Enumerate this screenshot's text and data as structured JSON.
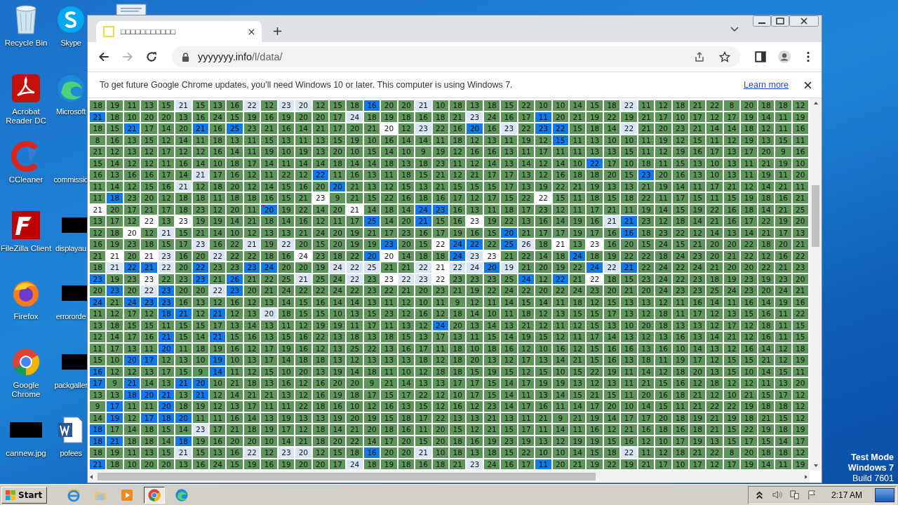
{
  "desktop": {
    "icons": [
      {
        "label": "Recycle Bin",
        "kind": "recycle"
      },
      {
        "label": "Acrobat Reader DC",
        "kind": "acrobat"
      },
      {
        "label": "CCleaner",
        "kind": "ccleaner"
      },
      {
        "label": "FileZilla Client",
        "kind": "filezilla"
      },
      {
        "label": "Firefox",
        "kind": "firefox"
      },
      {
        "label": "Google Chrome",
        "kind": "chrome"
      },
      {
        "label": "cannew.jpg",
        "kind": "redacted"
      }
    ],
    "icons_second_column": [
      {
        "label": "Skype",
        "kind": "skype"
      },
      {
        "label": "Microsoft",
        "kind": "edge"
      },
      {
        "label": "commissio",
        "kind": "blank"
      },
      {
        "label": "displayau",
        "kind": "redacted"
      },
      {
        "label": "errororde",
        "kind": "redacted"
      },
      {
        "label": "packgaller",
        "kind": "redacted"
      },
      {
        "label": "pofees",
        "kind": "word"
      }
    ],
    "watermark": [
      "Test Mode",
      "Windows 7",
      "Build 7601"
    ]
  },
  "browser": {
    "tab": {
      "title": "□□□□□□□□□□□"
    },
    "address": {
      "host": "yyyyyyy.info",
      "path": "/l/data/"
    },
    "infobar": {
      "message": "To get future Google Chrome updates, you'll need Windows 10 or later. This computer is using Windows 7.",
      "link": "Learn more"
    },
    "grid": {
      "rows": [
        {
          "cells": [
            "18",
            "19",
            "11",
            "13",
            "15",
            {
              "text": "21",
              "kind": "light"
            },
            "15",
            "13",
            "16",
            {
              "text": "22",
              "kind": "light"
            },
            "12",
            {
              "text": "23",
              "kind": "light"
            },
            {
              "text": "20",
              "kind": "light"
            },
            "12",
            "15",
            "18",
            {
              "text": "16",
              "kind": "blue"
            },
            "20",
            "20",
            {
              "text": "21",
              "kind": "light"
            },
            "10",
            "18",
            "13",
            "18",
            "15",
            "22",
            "10",
            "10",
            "14",
            "15",
            "18",
            {
              "text": "22",
              "kind": "light"
            },
            "11",
            "12",
            "18",
            "21",
            "22",
            "8",
            "20",
            "18",
            "18",
            "12"
          ]
        },
        {
          "cells": [
            {
              "text": "21",
              "kind": "blue"
            },
            "18",
            "10",
            "20",
            "20",
            "13",
            "16",
            "24",
            "15",
            "19",
            "16",
            "19",
            "20",
            "20",
            "17",
            {
              "text": "24",
              "kind": "light"
            },
            "18",
            "19",
            "18",
            "16",
            "18",
            "21",
            {
              "text": "23",
              "kind": "light"
            },
            "24",
            "16",
            "17",
            {
              "text": "11",
              "kind": "blue"
            },
            "20",
            "21",
            "19",
            "22",
            "19",
            "21",
            "17",
            "10",
            "17",
            "12",
            "17",
            "19",
            "14",
            "11",
            "19"
          ]
        },
        {
          "cells": [
            "18",
            "15",
            {
              "text": "21",
              "kind": "blue"
            },
            "17",
            "14",
            "20",
            {
              "text": "21",
              "kind": "blue"
            },
            "16",
            {
              "text": "25",
              "kind": "blue"
            },
            "23",
            "21",
            "16",
            "14",
            "21",
            "17",
            "20",
            "21",
            {
              "text": "20",
              "kind": "white"
            },
            "12",
            {
              "text": "23",
              "kind": "light"
            },
            "22",
            "16",
            {
              "text": "20",
              "kind": "blue"
            },
            "16",
            {
              "text": "23",
              "kind": "light"
            },
            "22",
            {
              "text": "23",
              "kind": "blue"
            },
            {
              "text": "22",
              "kind": "blue"
            },
            "15",
            "18",
            "14",
            {
              "text": "22",
              "kind": "light"
            },
            "21",
            "20",
            "23",
            "21",
            "14",
            "14",
            "18",
            "12",
            "11",
            "16"
          ]
        },
        {
          "cells": [
            "8",
            "16",
            "13",
            "15",
            "12",
            "14",
            "11",
            "18",
            "13",
            "11",
            "15",
            "13",
            "11",
            "13",
            "15",
            "19",
            "10",
            "16",
            "14",
            "14",
            "11",
            "18",
            "12",
            "13",
            "11",
            "19",
            "12",
            {
              "text": "15",
              "kind": "blue"
            },
            "11",
            "13",
            "10",
            "10",
            "11",
            "19",
            "12",
            "15",
            "11",
            "12",
            "19",
            "13",
            "15",
            "11"
          ]
        },
        {
          "cells": [
            "21",
            "12",
            "13",
            "12",
            "17",
            "12",
            "12",
            "16",
            "14",
            "11",
            "19",
            "10",
            "19",
            "13",
            "20",
            "10",
            "15",
            "14",
            "10",
            "9",
            "19",
            "12",
            "16",
            "16",
            "13",
            "11",
            "17",
            "11",
            "11",
            "13",
            "13",
            "15",
            "11",
            "12",
            "19",
            "16",
            "17",
            "13",
            "17",
            "20",
            "9",
            "16"
          ]
        },
        {
          "cells": [
            "15",
            "14",
            "12",
            "12",
            "11",
            "16",
            "14",
            "10",
            "18",
            "17",
            "14",
            "11",
            "14",
            "14",
            "18",
            "14",
            "14",
            "18",
            "13",
            "18",
            "23",
            "11",
            "12",
            "14",
            "13",
            "14",
            "12",
            "14",
            "10",
            {
              "text": "22",
              "kind": "blue"
            },
            "17",
            "10",
            "18",
            "11",
            "15",
            "13",
            "10",
            "13",
            "11",
            "21",
            "19",
            "10"
          ]
        },
        {
          "cells": [
            "16",
            "13",
            "16",
            "16",
            "17",
            "14",
            {
              "text": "21",
              "kind": "light"
            },
            "17",
            "16",
            "12",
            "11",
            "22",
            "12",
            {
              "text": "22",
              "kind": "blue"
            },
            "11",
            "16",
            "13",
            "11",
            "18",
            "15",
            "21",
            "12",
            "21",
            "17",
            "17",
            "13",
            "12",
            "16",
            "18",
            "18",
            "20",
            "15",
            {
              "text": "23",
              "kind": "blue"
            },
            "20",
            "16",
            "13",
            "10",
            "13",
            "11",
            "19",
            "11",
            "20"
          ]
        },
        {
          "cells": [
            "11",
            "14",
            "12",
            "15",
            "16",
            {
              "text": "21",
              "kind": "light"
            },
            "12",
            "18",
            "20",
            "12",
            "14",
            "15",
            "16",
            "20",
            {
              "text": "20",
              "kind": "blue"
            },
            "21",
            "13",
            "12",
            "15",
            "13",
            "21",
            "15",
            "15",
            "15",
            "17",
            "13",
            "19",
            "22",
            "21",
            "19",
            "13",
            "13",
            "21",
            "19",
            "14",
            "11",
            "17",
            "21",
            "12",
            "14",
            "21",
            "11"
          ]
        },
        {
          "cells": [
            "11",
            {
              "text": "18",
              "kind": "blue"
            },
            "23",
            "20",
            "12",
            "18",
            "18",
            "11",
            "18",
            "18",
            "16",
            "15",
            "21",
            {
              "text": "23",
              "kind": "white"
            },
            "9",
            "21",
            "15",
            "22",
            "16",
            "18",
            "16",
            "17",
            "12",
            "17",
            "15",
            "22",
            {
              "text": "22",
              "kind": "white"
            },
            "15",
            "11",
            "18",
            "15",
            "18",
            "22",
            "11",
            "17",
            "15",
            "11",
            "15",
            "19",
            "18",
            "16",
            "21"
          ]
        },
        {
          "cells": [
            {
              "text": "21",
              "kind": "white"
            },
            "20",
            "17",
            "21",
            "17",
            "18",
            "23",
            "12",
            "20",
            "11",
            {
              "text": "20",
              "kind": "blue"
            },
            "19",
            "22",
            "14",
            "20",
            {
              "text": "21",
              "kind": "white"
            },
            "14",
            "18",
            "14",
            {
              "text": "24",
              "kind": "blue"
            },
            {
              "text": "23",
              "kind": "blue"
            },
            "16",
            "13",
            "11",
            "18",
            "17",
            "23",
            "12",
            "11",
            "17",
            "21",
            "11",
            "19",
            "14",
            "15",
            "19",
            "22",
            "16",
            "18",
            "14",
            "21",
            "25"
          ]
        },
        {
          "cells": [
            "13",
            "17",
            "12",
            {
              "text": "22",
              "kind": "white"
            },
            "13",
            {
              "text": "23",
              "kind": "white"
            },
            "19",
            "19",
            "14",
            "21",
            "18",
            "14",
            "16",
            "12",
            "11",
            "17",
            {
              "text": "25",
              "kind": "blue"
            },
            "14",
            "20",
            {
              "text": "21",
              "kind": "blue"
            },
            "15",
            "16",
            {
              "text": "23",
              "kind": "white"
            },
            "19",
            "22",
            "13",
            "16",
            "14",
            "19",
            "16",
            {
              "text": "21",
              "kind": "light"
            },
            {
              "text": "21",
              "kind": "blue"
            },
            "23",
            "12",
            "18",
            "14",
            "21",
            "16",
            "17",
            "22",
            "19",
            "20"
          ]
        },
        {
          "cells": [
            "12",
            "18",
            {
              "text": "20",
              "kind": "white"
            },
            "12",
            {
              "text": "21",
              "kind": "light"
            },
            "15",
            "21",
            "14",
            "10",
            "12",
            "13",
            "13",
            "21",
            "24",
            "20",
            "19",
            "21",
            "17",
            "23",
            "16",
            "17",
            "19",
            "16",
            "15",
            {
              "text": "20",
              "kind": "blue"
            },
            "21",
            "17",
            "17",
            "19",
            "17",
            "16",
            {
              "text": "16",
              "kind": "blue"
            },
            "18",
            "23",
            "22",
            "12",
            "14",
            "13",
            "14",
            "21",
            "17",
            "13"
          ]
        },
        {
          "cells": [
            "16",
            "19",
            "23",
            "18",
            "15",
            "17",
            {
              "text": "23",
              "kind": "light"
            },
            "16",
            "22",
            {
              "text": "21",
              "kind": "light"
            },
            "19",
            {
              "text": "22",
              "kind": "light"
            },
            "20",
            "15",
            "20",
            "19",
            "19",
            {
              "text": "23",
              "kind": "blue"
            },
            "20",
            "15",
            {
              "text": "22",
              "kind": "white"
            },
            {
              "text": "24",
              "kind": "blue"
            },
            {
              "text": "22",
              "kind": "blue"
            },
            "22",
            {
              "text": "25",
              "kind": "blue"
            },
            {
              "text": "26",
              "kind": "light"
            },
            "18",
            {
              "text": "21",
              "kind": "white"
            },
            "13",
            {
              "text": "23",
              "kind": "white"
            },
            "16",
            "20",
            "15",
            "24",
            "15",
            "21",
            "20",
            "20",
            "22",
            "18",
            "20",
            "21"
          ]
        },
        {
          "cells": [
            "21",
            {
              "text": "21",
              "kind": "white"
            },
            "20",
            {
              "text": "21",
              "kind": "white"
            },
            {
              "text": "23",
              "kind": "light"
            },
            "16",
            "20",
            {
              "text": "22",
              "kind": "light"
            },
            "22",
            "22",
            "18",
            "16",
            {
              "text": "24",
              "kind": "white"
            },
            "23",
            "18",
            "22",
            {
              "text": "20",
              "kind": "blue"
            },
            {
              "text": "20",
              "kind": "white"
            },
            "14",
            "18",
            "18",
            {
              "text": "24",
              "kind": "blue"
            },
            {
              "text": "23",
              "kind": "light"
            },
            {
              "text": "23",
              "kind": "white"
            },
            "21",
            "22",
            "14",
            "18",
            {
              "text": "24",
              "kind": "blue"
            },
            "18",
            "19",
            "22",
            "22",
            "18",
            "24",
            "23",
            "20",
            "21",
            "22",
            "12",
            "16",
            "22"
          ]
        },
        {
          "cells": [
            "18",
            {
              "text": "21",
              "kind": "light"
            },
            {
              "text": "22",
              "kind": "blue"
            },
            {
              "text": "21",
              "kind": "blue"
            },
            {
              "text": "22",
              "kind": "light"
            },
            "20",
            {
              "text": "22",
              "kind": "blue"
            },
            "23",
            "23",
            {
              "text": "23",
              "kind": "blue"
            },
            {
              "text": "24",
              "kind": "blue"
            },
            "20",
            "20",
            "19",
            {
              "text": "24",
              "kind": "light"
            },
            {
              "text": "22",
              "kind": "light"
            },
            {
              "text": "25",
              "kind": "light"
            },
            "21",
            "21",
            {
              "text": "22",
              "kind": "light"
            },
            {
              "text": "21",
              "kind": "white"
            },
            {
              "text": "22",
              "kind": "light"
            },
            {
              "text": "24",
              "kind": "light"
            },
            {
              "text": "20",
              "kind": "blue"
            },
            {
              "text": "19",
              "kind": "light"
            },
            "21",
            "20",
            "19",
            "22",
            {
              "text": "24",
              "kind": "blue"
            },
            {
              "text": "22",
              "kind": "light"
            },
            {
              "text": "21",
              "kind": "blue"
            },
            "22",
            "24",
            "22",
            "24",
            "21",
            "20",
            "20",
            "22",
            "21",
            "23"
          ]
        },
        {
          "cells": [
            {
              "text": "23",
              "kind": "blue"
            },
            "19",
            "23",
            {
              "text": "23",
              "kind": "white"
            },
            "22",
            "23",
            {
              "text": "23",
              "kind": "blue"
            },
            "21",
            {
              "text": "26",
              "kind": "blue"
            },
            "21",
            "22",
            "25",
            {
              "text": "21",
              "kind": "light"
            },
            "25",
            "24",
            {
              "text": "22",
              "kind": "light"
            },
            "23",
            {
              "text": "23",
              "kind": "white"
            },
            {
              "text": "22",
              "kind": "light"
            },
            {
              "text": "23",
              "kind": "light"
            },
            {
              "text": "22",
              "kind": "white"
            },
            "23",
            "23",
            "23",
            "25",
            {
              "text": "24",
              "kind": "blue"
            },
            "12",
            {
              "text": "22",
              "kind": "blue"
            },
            "21",
            {
              "text": "22",
              "kind": "white"
            },
            "18",
            "15",
            "23",
            "24",
            "22",
            "23",
            "18",
            "19",
            "23",
            "19",
            "23",
            "20"
          ]
        },
        {
          "cells": [
            "20",
            {
              "text": "23",
              "kind": "blue"
            },
            "20",
            {
              "text": "22",
              "kind": "light"
            },
            {
              "text": "23",
              "kind": "blue"
            },
            "20",
            "20",
            {
              "text": "22",
              "kind": "light"
            },
            {
              "text": "23",
              "kind": "blue"
            },
            "20",
            "21",
            "24",
            "22",
            "22",
            "24",
            "22",
            "23",
            "22",
            "21",
            "20",
            "23",
            "21",
            "19",
            "22",
            "24",
            "22",
            "20",
            "22",
            "24",
            "23",
            "20",
            "21",
            "20",
            "24",
            "23",
            "23",
            "25",
            "24",
            "23",
            "20",
            "24",
            "21"
          ]
        },
        {
          "cells": [
            {
              "text": "24",
              "kind": "blue"
            },
            "21",
            {
              "text": "24",
              "kind": "blue"
            },
            {
              "text": "23",
              "kind": "blue"
            },
            {
              "text": "23",
              "kind": "blue"
            },
            "16",
            "13",
            "12",
            "16",
            "12",
            "13",
            "14",
            "15",
            "16",
            "14",
            "14",
            "13",
            "11",
            "12",
            "10",
            "11",
            "9",
            "12",
            "11",
            "14",
            "15",
            "14",
            "11",
            "18",
            "12",
            "15",
            "13",
            "13",
            "12",
            "11",
            "16",
            "14",
            "11",
            "16",
            "14",
            "19",
            "16"
          ]
        },
        {
          "cells": [
            "11",
            "12",
            "17",
            "12",
            {
              "text": "18",
              "kind": "blue"
            },
            {
              "text": "21",
              "kind": "blue"
            },
            "12",
            {
              "text": "21",
              "kind": "blue"
            },
            "12",
            "13",
            {
              "text": "20",
              "kind": "light"
            },
            "18",
            "15",
            "15",
            "10",
            "13",
            "15",
            "23",
            "12",
            "16",
            "12",
            "18",
            "14",
            "10",
            "11",
            "18",
            "12",
            "13",
            "15",
            "15",
            "17",
            "13",
            "12",
            "18",
            "11",
            "17",
            "12",
            "13",
            "15",
            "16",
            "11",
            "22"
          ]
        },
        {
          "cells": [
            "13",
            "18",
            "15",
            "15",
            "11",
            "15",
            "15",
            "17",
            "13",
            "14",
            "13",
            "11",
            "12",
            "19",
            "19",
            "11",
            "17",
            "11",
            "13",
            "12",
            {
              "text": "24",
              "kind": "blue"
            },
            "20",
            "13",
            "14",
            "13",
            "21",
            "12",
            "11",
            "12",
            "15",
            "13",
            "10",
            "20",
            "18",
            "13",
            "13",
            "12",
            "17",
            "12",
            "18",
            "11",
            "15"
          ]
        },
        {
          "cells": [
            "12",
            "14",
            "17",
            "16",
            {
              "text": "21",
              "kind": "blue"
            },
            "15",
            "14",
            {
              "text": "21",
              "kind": "blue"
            },
            "15",
            "16",
            "13",
            "15",
            "16",
            "22",
            "13",
            "18",
            "13",
            "18",
            "15",
            "13",
            "17",
            "13",
            "11",
            "15",
            "14",
            "19",
            "15",
            "12",
            "11",
            "17",
            "14",
            "13",
            "12",
            "13",
            "16",
            "13",
            "14",
            "21",
            "12",
            "16",
            "11",
            "15"
          ]
        },
        {
          "cells": [
            "11",
            "17",
            "13",
            "11",
            {
              "text": "20",
              "kind": "blue"
            },
            "11",
            "18",
            "19",
            "16",
            "12",
            "17",
            "19",
            "16",
            "12",
            "13",
            "25",
            "22",
            "13",
            "16",
            "17",
            "11",
            "18",
            "10",
            "18",
            "16",
            "12",
            "10",
            "16",
            "12",
            "15",
            "16",
            "16",
            "13",
            "16",
            "10",
            "14",
            "13",
            "12",
            "16",
            "14",
            "12",
            "18"
          ]
        },
        {
          "cells": [
            "15",
            "10",
            {
              "text": "20",
              "kind": "blue"
            },
            {
              "text": "17",
              "kind": "blue"
            },
            "12",
            "13",
            "10",
            {
              "text": "19",
              "kind": "blue"
            },
            "10",
            "13",
            "17",
            "14",
            "18",
            "18",
            "13",
            "12",
            "13",
            "13",
            "13",
            "18",
            "12",
            "18",
            "20",
            "13",
            "12",
            "17",
            "13",
            "14",
            "21",
            "15",
            "16",
            "13",
            "18",
            "11",
            "19",
            "17",
            "12",
            "15",
            "15",
            "21",
            "12",
            "19"
          ]
        },
        {
          "cells": [
            {
              "text": "16",
              "kind": "blue"
            },
            "12",
            "12",
            "13",
            "17",
            "15",
            "9",
            {
              "text": "14",
              "kind": "blue"
            },
            "11",
            "12",
            "15",
            "10",
            "20",
            "13",
            "19",
            "14",
            "18",
            "11",
            "10",
            "12",
            "18",
            "18",
            "15",
            "19",
            "15",
            "12",
            "15",
            "10",
            "15",
            "22",
            "19",
            "11",
            "14",
            "12",
            "18",
            "20",
            "13",
            "15",
            "10",
            "14",
            "15",
            "11"
          ]
        },
        {
          "cells": [
            {
              "text": "17",
              "kind": "blue"
            },
            "9",
            {
              "text": "21",
              "kind": "blue"
            },
            "14",
            "13",
            {
              "text": "21",
              "kind": "blue"
            },
            {
              "text": "20",
              "kind": "blue"
            },
            "10",
            "21",
            "18",
            "13",
            "16",
            "12",
            "16",
            "20",
            "20",
            "9",
            "21",
            "14",
            "13",
            "13",
            "17",
            "17",
            "15",
            "14",
            "17",
            "19",
            "19",
            "13",
            "12",
            "13",
            "11",
            "21",
            "15",
            "16",
            "12",
            "18",
            "12",
            "12",
            "11",
            "13",
            "20"
          ]
        },
        {
          "cells": [
            "13",
            "13",
            {
              "text": "18",
              "kind": "blue"
            },
            {
              "text": "20",
              "kind": "blue"
            },
            {
              "text": "21",
              "kind": "blue"
            },
            "13",
            {
              "text": "21",
              "kind": "blue"
            },
            "12",
            "14",
            "21",
            "21",
            "13",
            "12",
            "16",
            "19",
            "18",
            "17",
            "15",
            "17",
            "22",
            "12",
            "10",
            "17",
            "15",
            "14",
            "11",
            "13",
            "14",
            "15",
            "21",
            "15",
            "11",
            "20",
            "16",
            "18",
            "21",
            "12",
            "10",
            "21",
            "15",
            "17",
            "12"
          ]
        },
        {
          "cells": [
            "9",
            {
              "text": "17",
              "kind": "blue"
            },
            "11",
            "11",
            {
              "text": "20",
              "kind": "blue"
            },
            "18",
            "19",
            "12",
            "13",
            "17",
            "11",
            "11",
            "22",
            "18",
            "16",
            "10",
            "12",
            "16",
            "13",
            "15",
            "12",
            "16",
            "12",
            "23",
            "14",
            "17",
            "16",
            "11",
            "14",
            "17",
            "20",
            "10",
            "14",
            "15",
            "11",
            "21",
            "22",
            "22",
            "19",
            "18",
            "18",
            "12"
          ]
        },
        {
          "cells": [
            "14",
            {
              "text": "19",
              "kind": "blue"
            },
            "12",
            {
              "text": "17",
              "kind": "blue"
            },
            {
              "text": "18",
              "kind": "blue"
            },
            {
              "text": "20",
              "kind": "blue"
            },
            "11",
            "11",
            "16",
            "14",
            "13",
            "19",
            "13",
            "13",
            "19",
            "20",
            "19",
            "15",
            "18",
            "17",
            "22",
            "13",
            "13",
            "21",
            "13",
            "11",
            "21",
            "9",
            "21",
            "19",
            "14",
            "17",
            "17",
            "20",
            "18",
            "19",
            "21",
            "19",
            "18",
            "21",
            "15",
            "12"
          ]
        },
        {
          "cells": [
            {
              "text": "18",
              "kind": "blue"
            },
            "17",
            "14",
            "18",
            "15",
            "14",
            {
              "text": "23",
              "kind": "light"
            },
            "17",
            "21",
            "18",
            "19",
            "17",
            "12",
            "18",
            "14",
            "21",
            "20",
            "18",
            "16",
            "11",
            "20",
            "15",
            "12",
            "21",
            "15",
            "17",
            "11",
            "14",
            "11",
            "16",
            "12",
            "21",
            "16",
            "18",
            "16",
            "18",
            "21",
            "15",
            "22",
            "19",
            "18",
            "19"
          ]
        },
        {
          "cells": [
            {
              "text": "18",
              "kind": "blue"
            },
            {
              "text": "21",
              "kind": "blue"
            },
            "18",
            "18",
            "14",
            {
              "text": "18",
              "kind": "blue"
            },
            "19",
            "16",
            "20",
            "20",
            "10",
            "14",
            "21",
            "18",
            "20",
            "22",
            "14",
            "17",
            "20",
            "15",
            "20",
            "18",
            "16",
            "19",
            "23",
            "19",
            "13",
            "12",
            "19",
            "19",
            "15",
            "16",
            "12",
            "10",
            "17",
            "19",
            "13",
            "15",
            "17",
            "15",
            "14",
            "17"
          ]
        },
        {
          "cells": [
            "18",
            "19",
            "11",
            "13",
            "15",
            {
              "text": "21",
              "kind": "light"
            },
            "15",
            "13",
            "16",
            {
              "text": "22",
              "kind": "light"
            },
            "12",
            {
              "text": "23",
              "kind": "light"
            },
            {
              "text": "20",
              "kind": "light"
            },
            "12",
            "15",
            "18",
            {
              "text": "16",
              "kind": "blue"
            },
            "20",
            "20",
            {
              "text": "21",
              "kind": "light"
            },
            "10",
            "18",
            "13",
            "18",
            "15",
            "22",
            "10",
            "10",
            "14",
            "15",
            "18",
            {
              "text": "22",
              "kind": "light"
            },
            "11",
            "12",
            "18",
            "21",
            "22",
            "8",
            "20",
            "18",
            "18",
            "12"
          ]
        },
        {
          "cells": [
            {
              "text": "21",
              "kind": "blue"
            },
            "18",
            "10",
            "20",
            "20",
            "13",
            "16",
            "24",
            "15",
            "19",
            "16",
            "19",
            "20",
            "20",
            "17",
            {
              "text": "24",
              "kind": "light"
            },
            "18",
            "19",
            "18",
            "16",
            "18",
            "21",
            {
              "text": "23",
              "kind": "light"
            },
            "24",
            "16",
            "17",
            {
              "text": "11",
              "kind": "blue"
            },
            "20",
            "21",
            "19",
            "22",
            "19",
            "21",
            "17",
            "10",
            "17",
            "12",
            "17",
            "19",
            "14",
            "11",
            "19"
          ]
        }
      ]
    }
  },
  "taskbar": {
    "start": "Start",
    "apps": [
      {
        "kind": "ie",
        "selected": false
      },
      {
        "kind": "folder",
        "selected": false
      },
      {
        "kind": "media",
        "selected": false
      },
      {
        "kind": "chrome",
        "selected": true
      },
      {
        "kind": "edge",
        "selected": false
      }
    ],
    "clock": "2:17 AM"
  }
}
